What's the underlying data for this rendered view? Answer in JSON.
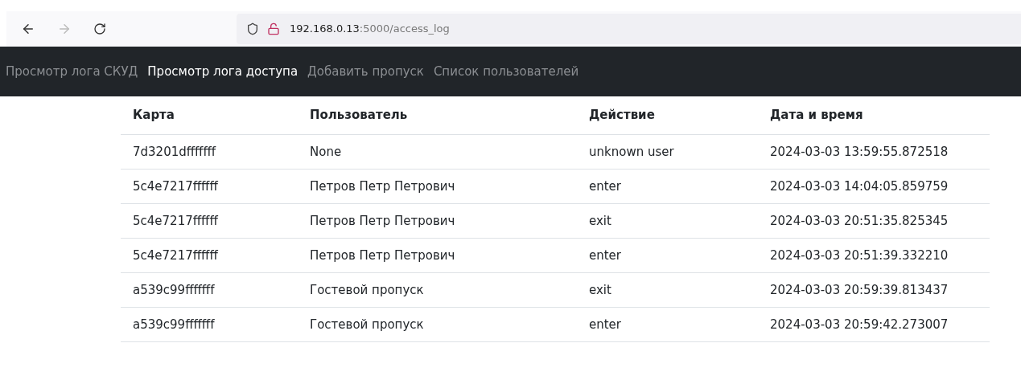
{
  "browser": {
    "url_host": "192.168.0.13",
    "url_path": ":5000/access_log"
  },
  "nav": [
    {
      "label": "Просмотр лога СКУД",
      "selected": false
    },
    {
      "label": "Просмотр лога доступа",
      "selected": true
    },
    {
      "label": "Добавить пропуск",
      "selected": false
    },
    {
      "label": "Список пользователей",
      "selected": false
    }
  ],
  "table": {
    "columns": [
      "Карта",
      "Пользователь",
      "Действие",
      "Дата и время"
    ],
    "rows": [
      [
        "7d3201dfffffff",
        "None",
        "unknown user",
        "2024-03-03 13:59:55.872518"
      ],
      [
        "5c4e7217ffffff",
        "Петров Петр Петрович",
        "enter",
        "2024-03-03 14:04:05.859759"
      ],
      [
        "5c4e7217ffffff",
        "Петров Петр Петрович",
        "exit",
        "2024-03-03 20:51:35.825345"
      ],
      [
        "5c4e7217ffffff",
        "Петров Петр Петрович",
        "enter",
        "2024-03-03 20:51:39.332210"
      ],
      [
        "a539c99fffffff",
        "Гостевой пропуск",
        "exit",
        "2024-03-03 20:59:39.813437"
      ],
      [
        "a539c99fffffff",
        "Гостевой пропуск",
        "enter",
        "2024-03-03 20:59:42.273007"
      ]
    ]
  }
}
